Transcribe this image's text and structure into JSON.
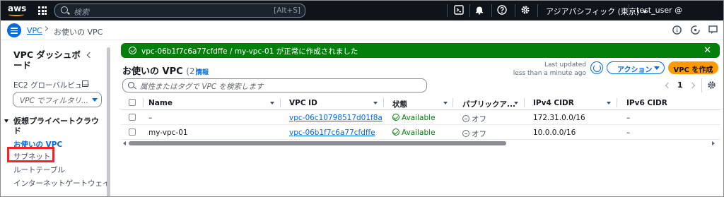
{
  "topnav": {
    "logo_text": "aws",
    "search_placeholder": "検索",
    "search_shortcut": "[Alt+S]",
    "region": "アジアパシフィック (東京)",
    "user": "test_user @"
  },
  "breadcrumb": {
    "root": "VPC",
    "current": "お使いの VPC"
  },
  "sidebar": {
    "title": "VPC ダッシュボード",
    "ec2_link": "EC2 グローバルビュー",
    "filter_placeholder": "VPC でフィルタリ...",
    "section": "仮想プライベートクラウド",
    "items": [
      {
        "label": "お使いの VPC",
        "active": true
      },
      {
        "label": "サブネット",
        "active": false
      },
      {
        "label": "ルートテーブル",
        "active": false
      },
      {
        "label": "インターネットゲートウェイ",
        "active": false
      }
    ]
  },
  "flash": {
    "message": "vpc-06b1f7c6a77cfdffe / my-vpc-01 が正常に作成されました",
    "status_color": "#037f0c"
  },
  "header": {
    "title": "お使いの VPC",
    "count": "(2)",
    "info": "情報",
    "last_updated_line1": "Last updated",
    "last_updated_line2": "less than a minute ago",
    "actions_label": "アクション",
    "create_label": "VPC を作成"
  },
  "table": {
    "search_placeholder": "属性またはタグで VPC を検索します",
    "page": "1",
    "columns": [
      "Name",
      "VPC ID",
      "状態",
      "パブリックア...",
      "IPv4 CIDR",
      "IPv6 CIDR"
    ],
    "rows": [
      {
        "name": "–",
        "vpc_id": "vpc-06c10798517d01f8a",
        "state": "Available",
        "public": "オフ",
        "ipv4": "172.31.0.0/16",
        "ipv6": "–"
      },
      {
        "name": "my-vpc-01",
        "vpc_id": "vpc-06b1f7c6a77cfdffe",
        "state": "Available",
        "public": "オフ",
        "ipv4": "10.0.0.0/16",
        "ipv6": "–"
      }
    ]
  },
  "colors": {
    "accent": "#006ce0",
    "primary_button": "#ff9900",
    "highlight_box": "#ff1f1f"
  },
  "icons": [
    "services-grid-icon",
    "search-icon",
    "cloudshell-icon",
    "bell-icon",
    "help-icon",
    "gear-icon",
    "menu-icon",
    "info-icon",
    "notification-icon",
    "feedback-icon",
    "refresh-icon",
    "settings-icon",
    "external-link-icon"
  ]
}
